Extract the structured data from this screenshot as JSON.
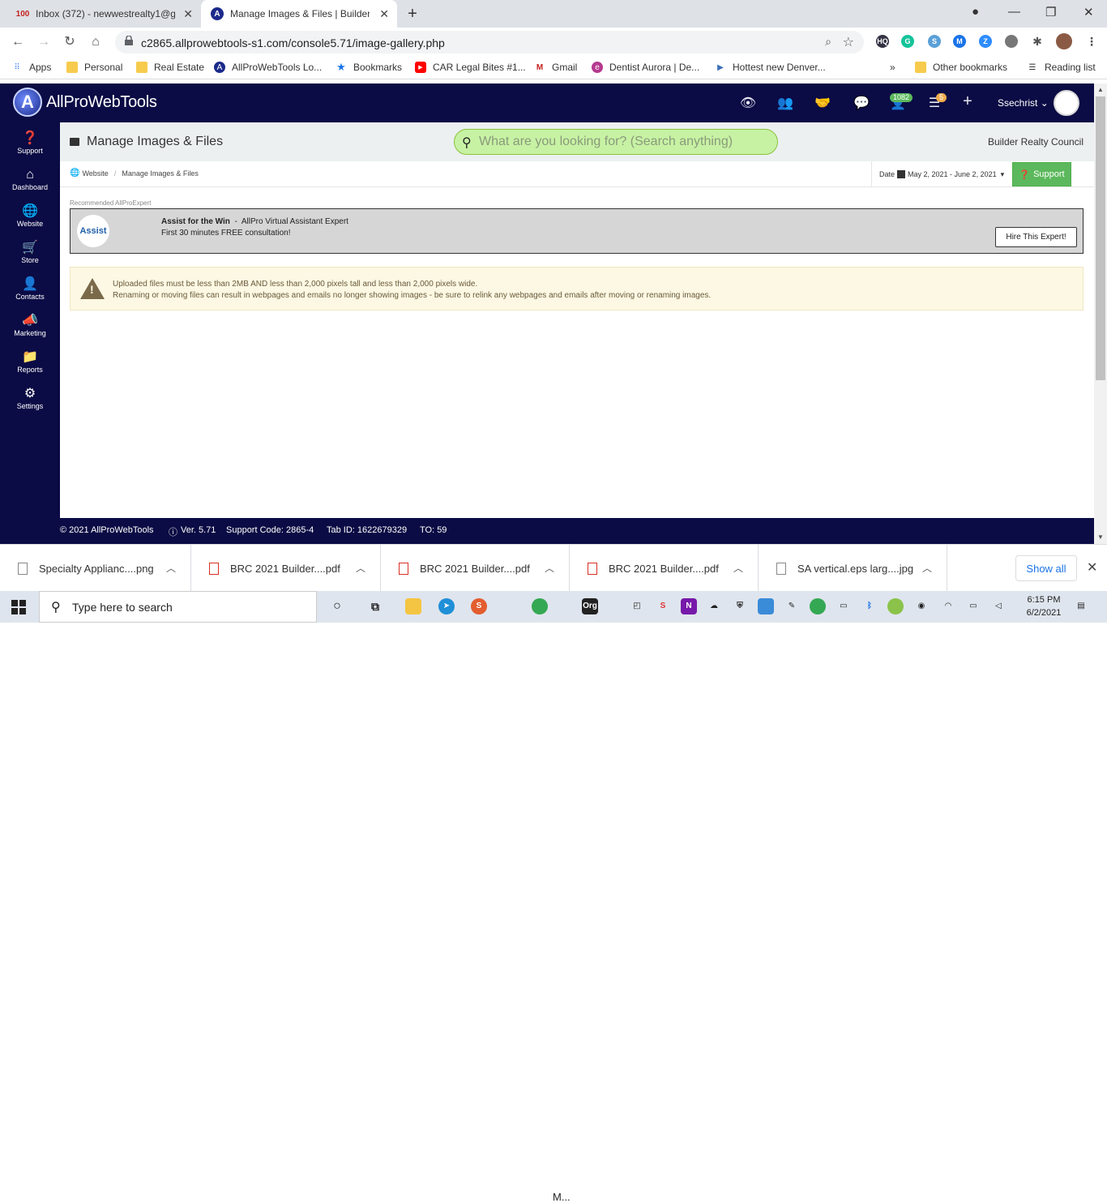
{
  "browser": {
    "tabs": [
      {
        "title": "Inbox (372) - newwestrealty1@gm",
        "favicon": "100-icon"
      },
      {
        "title": "Manage Images & Files | Builder",
        "favicon": "allpro-icon"
      }
    ],
    "url": "c2865.allprowebtools-s1.com/console5.71/image-gallery.php",
    "bookmarks": [
      "Apps",
      "Personal",
      "Real Estate",
      "AllProWebTools Lo...",
      "Bookmarks",
      "CAR Legal Bites #1...",
      "Gmail",
      "Dentist Aurora | De...",
      "Hottest new Denver..."
    ],
    "other_bookmarks": "Other bookmarks",
    "reading_list": "Reading list"
  },
  "header": {
    "logo_text": "AllProWebTools",
    "badge_users": "1082",
    "badge_tasks": "5",
    "username": "Ssechrist"
  },
  "sidebar": {
    "items": [
      {
        "label": "Support",
        "icon": "question-icon"
      },
      {
        "label": "Dashboard",
        "icon": "home-icon"
      },
      {
        "label": "Website",
        "icon": "globe-icon"
      },
      {
        "label": "Store",
        "icon": "cart-icon"
      },
      {
        "label": "Contacts",
        "icon": "user-icon"
      },
      {
        "label": "Marketing",
        "icon": "megaphone-icon"
      },
      {
        "label": "Reports",
        "icon": "folder-icon"
      },
      {
        "label": "Settings",
        "icon": "gear-icon"
      }
    ]
  },
  "page": {
    "title": "Manage Images & Files",
    "search_placeholder": "What are you looking for? (Search anything)",
    "org_name": "Builder Realty Council",
    "breadcrumb": [
      "Website",
      "Manage Images & Files"
    ],
    "date_label": "Date",
    "date_range": "May 2, 2021 - June 2, 2021",
    "support_label": "Support"
  },
  "expert": {
    "section_label": "Recommended AllProExpert",
    "logo_text": "Assist",
    "name": "Assist for the Win",
    "role": "AllPro Virtual Assistant Expert",
    "offer": "First 30 minutes FREE consultation!",
    "hire_label": "Hire This Expert!"
  },
  "warning": {
    "line1": "Uploaded files must be less than 2MB AND less than 2,000 pixels tall and less than 2,000 pixels wide.",
    "line2": "Renaming or moving files can result in webpages and emails no longer showing images - be sure to relink any webpages and emails after moving or renaming images."
  },
  "footer": {
    "copyright": "© 2021 AllProWebTools",
    "version": "Ver. 5.71",
    "support_code": "Support Code: 2865-4",
    "tab_id": "Tab ID: 1622679329",
    "to": "TO: 59"
  },
  "downloads": {
    "items": [
      {
        "name": "Specialty Applianc....png",
        "type": "image"
      },
      {
        "name": "BRC 2021 Builder....pdf",
        "type": "pdf"
      },
      {
        "name": "BRC 2021 Builder....pdf",
        "type": "pdf"
      },
      {
        "name": "BRC 2021 Builder....pdf",
        "type": "pdf"
      },
      {
        "name": "SA vertical.eps larg....jpg",
        "type": "image"
      }
    ],
    "show_all": "Show all"
  },
  "taskbar": {
    "search_text": "Type here to search",
    "chrome_label": "M...",
    "time": "6:15 PM",
    "date": "6/2/2021"
  },
  "colors": {
    "nav_bg": "#0b0b45",
    "accent_green": "#5cb85c",
    "search_bg": "#c7f2a4",
    "warning_bg": "#fcf8e3"
  }
}
